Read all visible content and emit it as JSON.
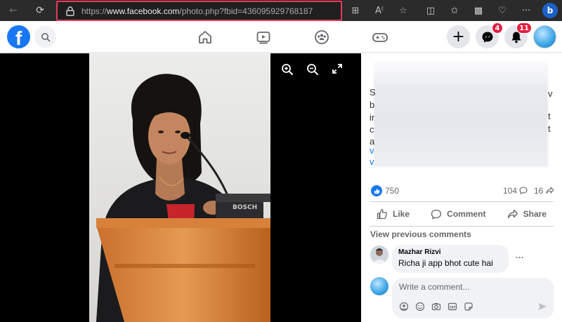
{
  "browser": {
    "url_prefix": "https://",
    "url_host": "www.facebook.com",
    "url_path": "/photo.php?fbid=436095929768187"
  },
  "header": {
    "logo_letter": "f",
    "messenger_badge": "4",
    "notifications_badge": "11"
  },
  "panel": {
    "edge_left": [
      "S",
      "b",
      "ir",
      "c",
      "a",
      "v",
      "v"
    ],
    "edge_right": [
      "v",
      "t",
      "t"
    ],
    "stats": {
      "likes": "750",
      "comments": "104",
      "shares": "16"
    },
    "actions": {
      "like": "Like",
      "comment": "Comment",
      "share": "Share"
    },
    "view_previous": "View previous comments",
    "comment": {
      "author": "Mazhar Rizvi",
      "text": "Richa ji app bhot cute hai",
      "more": "···"
    },
    "write_placeholder": "Write a comment..."
  },
  "colors": {
    "facebook_blue": "#1877f2",
    "highlight_border": "#e8385a",
    "badge_red": "#e41e3f"
  }
}
